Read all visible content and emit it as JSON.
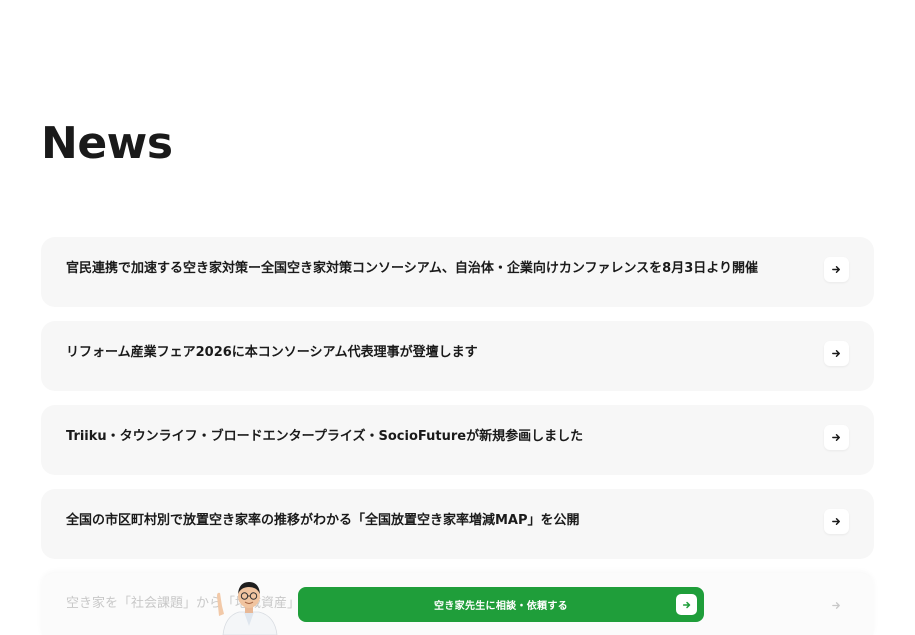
{
  "section": {
    "heading": "News"
  },
  "news": [
    {
      "title": "官民連携で加速する空き家対策ー全国空き家対策コンソーシアム、自治体・企業向けカンファレンスを8月3日より開催"
    },
    {
      "title": "リフォーム産業フェア2026に本コンソーシアム代表理事が登壇します"
    },
    {
      "title": "Triiku・タウンライフ・ブロードエンタープライズ・SocioFutureが新規参画しました"
    },
    {
      "title": "全国の市区町村別で放置空き家率の推移がわかる「全国放置空き家率増減MAP」を公開"
    },
    {
      "title": "空き家を「社会課題」から「地域資産」"
    }
  ],
  "cta": {
    "label": "空き家先生に相談・依頼する"
  },
  "icons": {
    "arrow": "arrow-right-icon",
    "avatar": "advisor-avatar"
  },
  "colors": {
    "cta_green": "#1f9e3a",
    "card_bg": "#f7f7f7",
    "text": "#1a1a1a"
  }
}
